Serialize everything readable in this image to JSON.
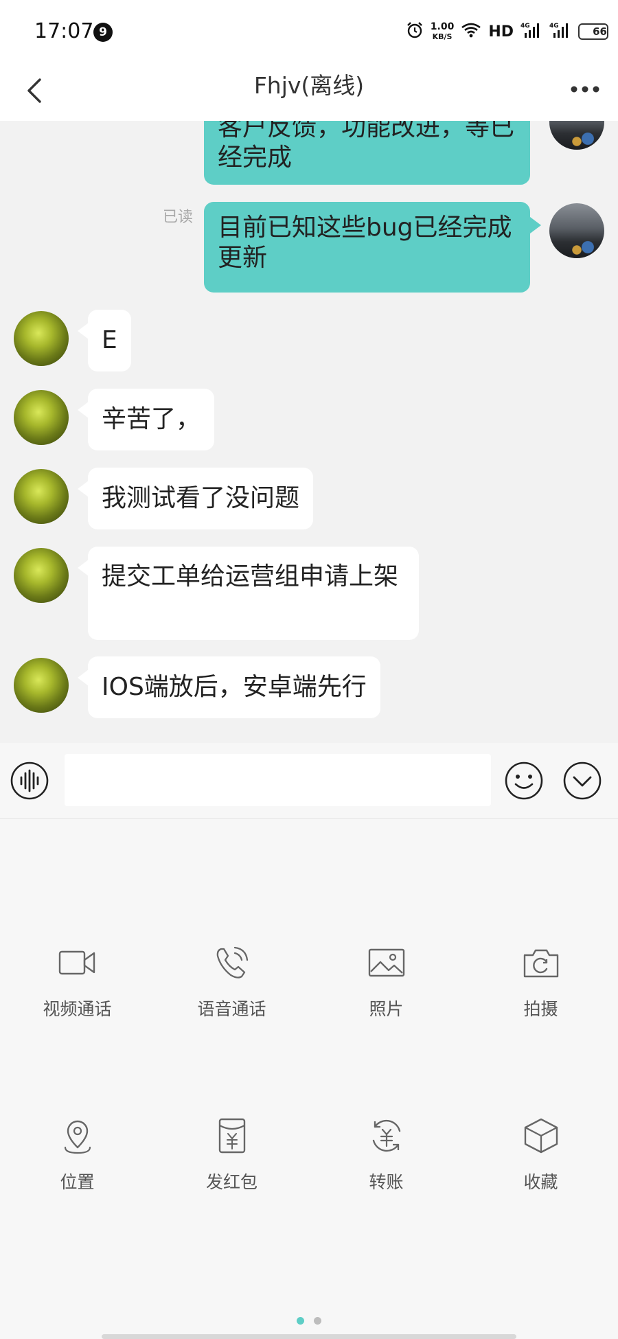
{
  "status_bar": {
    "time": "17:07",
    "notification_count": "9",
    "net_speed_value": "1.00",
    "net_speed_unit": "KB/S",
    "hd_label": "HD",
    "battery_level": "66",
    "battery_fraction": 0.66
  },
  "nav": {
    "title": "Fhjv(离线)",
    "back_icon": "chevron-left-icon",
    "more_icon": "more-dots-icon"
  },
  "messages": {
    "m1_text": "客户反馈，功能改进，等已经完成",
    "m2_read": "已读",
    "m2_text": "目前已知这些bug已经完成更新",
    "m3_text": "E",
    "m4_text": "辛苦了，",
    "m5_text": "我测试看了没问题",
    "m6_text": "提交工单给运营组申请上架",
    "m7_text": "IOS端放后，安卓端先行"
  },
  "input_bar": {
    "value": "",
    "voice_icon": "voice-wave-icon",
    "emoji_icon": "emoji-smile-icon",
    "collapse_icon": "chevron-down-circle-icon"
  },
  "tools": {
    "video_call": "视频通话",
    "voice_call": "语音通话",
    "photo": "照片",
    "camera": "拍摄",
    "location": "位置",
    "red_packet": "发红包",
    "transfer": "转账",
    "favorites": "收藏"
  },
  "pager": {
    "current_page": 1,
    "total_pages": 2
  },
  "colors": {
    "accent": "#5ecec6",
    "chat_bg": "#f2f2f2",
    "panel_bg": "#f7f7f7"
  }
}
